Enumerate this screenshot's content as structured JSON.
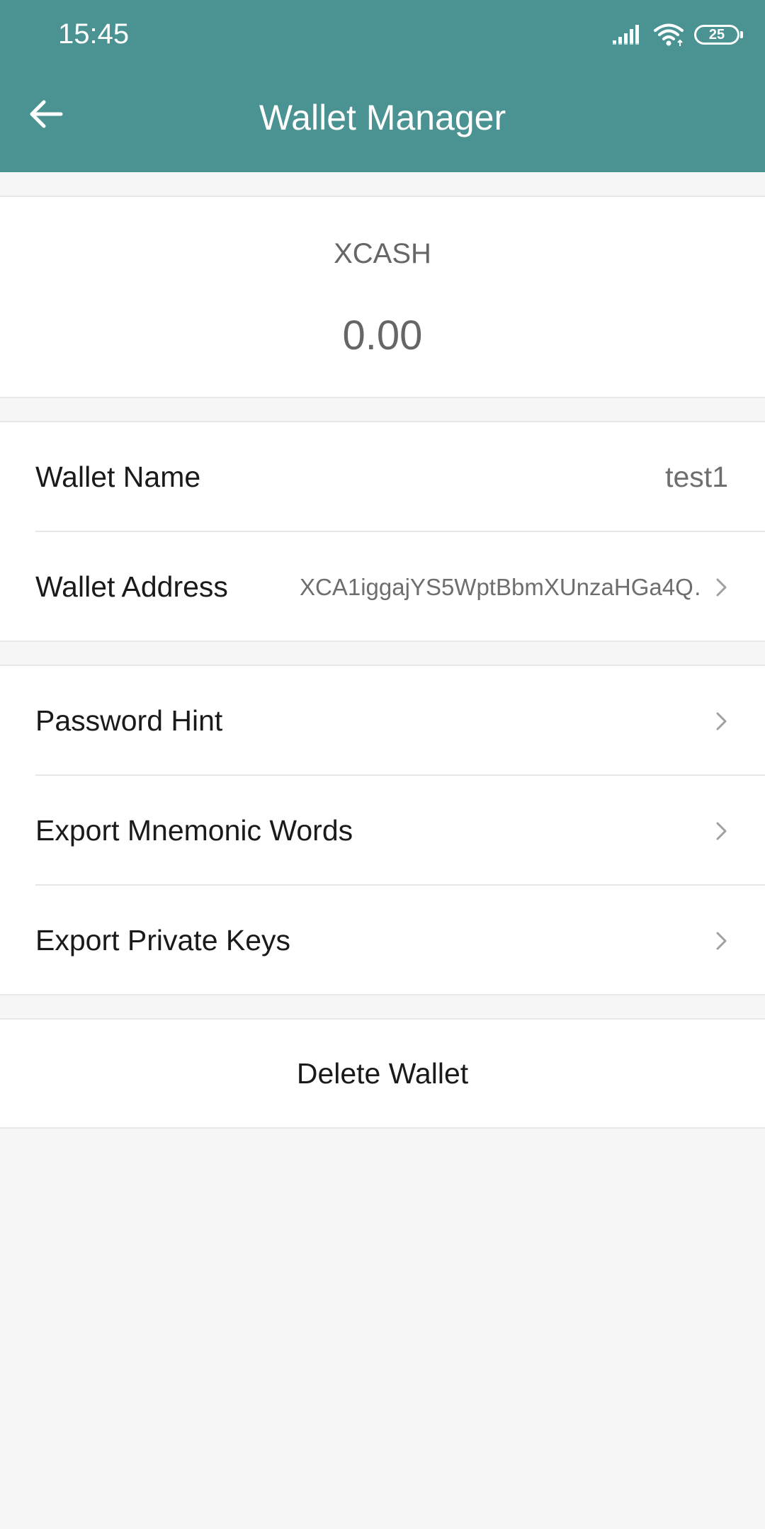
{
  "status_bar": {
    "time": "15:45",
    "battery": "25",
    "icons": [
      "signal-icon",
      "wifi-icon",
      "battery-icon"
    ]
  },
  "nav": {
    "title": "Wallet Manager",
    "back_icon": "arrow-left-icon"
  },
  "balance": {
    "coin": "XCASH",
    "amount": "0.00"
  },
  "wallet_info": {
    "name_label": "Wallet Name",
    "name_value": "test1",
    "address_label": "Wallet Address",
    "address_value": "XCA1iggajYS5WptBbmXUnzaHGa4Q…"
  },
  "security": {
    "items": [
      {
        "label": "Password Hint"
      },
      {
        "label": "Export Mnemonic Words"
      },
      {
        "label": "Export Private Keys"
      }
    ]
  },
  "delete": {
    "label": "Delete Wallet"
  },
  "colors": {
    "header_bg": "#4a9392",
    "page_bg": "#f6f6f6",
    "card_bg": "#ffffff"
  }
}
